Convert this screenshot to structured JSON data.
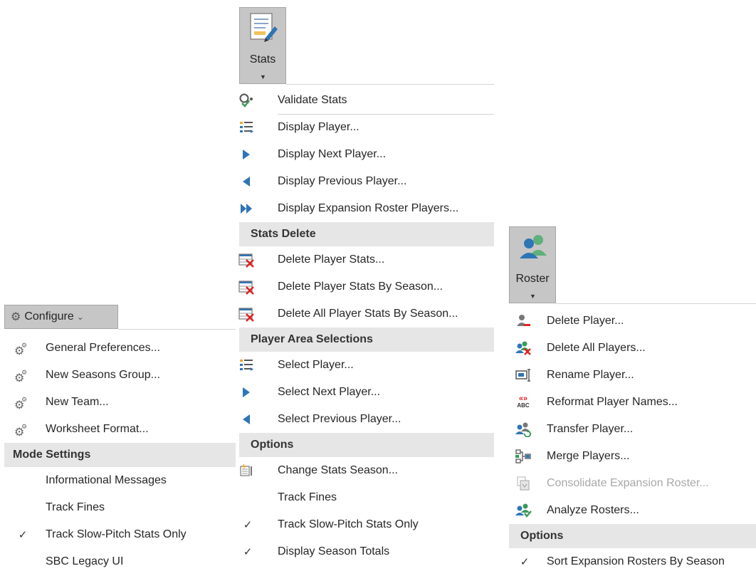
{
  "stats_button": {
    "label": "Stats",
    "icon": "stats-notepad-icon"
  },
  "roster_button": {
    "label": "Roster",
    "icon": "roster-people-icon"
  },
  "configure": {
    "label": "Configure",
    "chevron": "⌄",
    "items": [
      {
        "label": "General Preferences...",
        "icon": "gear-cluster-icon"
      },
      {
        "label": "New Seasons Group...",
        "icon": "gear-cluster-icon"
      },
      {
        "label": "New Team...",
        "icon": "gear-cluster-icon"
      },
      {
        "label": "Worksheet Format...",
        "icon": "gear-cluster-icon"
      }
    ],
    "mode_header": "Mode Settings",
    "mode_items": [
      {
        "label": "Informational Messages",
        "checked": false
      },
      {
        "label": "Track Fines",
        "checked": false
      },
      {
        "label": "Track Slow-Pitch Stats Only",
        "checked": true
      },
      {
        "label": "SBC Legacy UI",
        "checked": false
      }
    ]
  },
  "stats_menu": {
    "items": [
      {
        "label": "Validate Stats",
        "icon": "validate-icon"
      },
      {
        "label": "Display Player...",
        "icon": "list-select-icon"
      },
      {
        "label": "Display Next Player...",
        "icon": "triangle-right-icon"
      },
      {
        "label": "Display Previous Player...",
        "icon": "triangle-left-icon"
      },
      {
        "label": "Display Expansion Roster Players...",
        "icon": "double-triangle-right-icon"
      }
    ],
    "delete_header": "Stats Delete",
    "delete_items": [
      {
        "label": "Delete Player Stats...",
        "icon": "delete-table-icon"
      },
      {
        "label": "Delete Player Stats By Season...",
        "icon": "delete-table-icon"
      },
      {
        "label": "Delete All Player Stats By Season...",
        "icon": "delete-table-icon"
      }
    ],
    "area_header": "Player Area Selections",
    "area_items": [
      {
        "label": "Select Player...",
        "icon": "list-select-icon"
      },
      {
        "label": "Select Next Player...",
        "icon": "triangle-right-icon"
      },
      {
        "label": "Select Previous Player...",
        "icon": "triangle-left-icon"
      }
    ],
    "options_header": "Options",
    "options_items": [
      {
        "label": "Change Stats Season...",
        "icon": "change-season-icon",
        "checked": false
      },
      {
        "label": "Track Fines",
        "icon": "",
        "checked": false
      },
      {
        "label": "Track Slow-Pitch Stats Only",
        "icon": "",
        "checked": true
      },
      {
        "label": "Display Season Totals",
        "icon": "",
        "checked": true
      }
    ]
  },
  "roster_menu": {
    "items": [
      {
        "label": "Delete Player...",
        "icon": "person-minus-icon",
        "disabled": false
      },
      {
        "label": "Delete All Players...",
        "icon": "people-delete-icon",
        "disabled": false
      },
      {
        "label": "Rename Player...",
        "icon": "rename-icon",
        "disabled": false
      },
      {
        "label": "Reformat Player Names...",
        "icon": "reformat-abc-icon",
        "disabled": false
      },
      {
        "label": "Transfer Player...",
        "icon": "transfer-people-icon",
        "disabled": false
      },
      {
        "label": "Merge Players...",
        "icon": "merge-icon",
        "disabled": false
      },
      {
        "label": "Consolidate Expansion Roster...",
        "icon": "consolidate-icon",
        "disabled": true
      },
      {
        "label": "Analyze Rosters...",
        "icon": "analyze-people-icon",
        "disabled": false
      }
    ],
    "options_header": "Options",
    "options_items": [
      {
        "label": "Sort Expansion Rosters By Season",
        "checked": true
      }
    ],
    "reformat_glyph_top": "«»",
    "reformat_glyph_bottom": "ABC"
  },
  "colors": {
    "header_bg": "#e6e6e6",
    "blue": "#2e75b6",
    "red": "#e02020",
    "green": "#3a9a5a"
  }
}
